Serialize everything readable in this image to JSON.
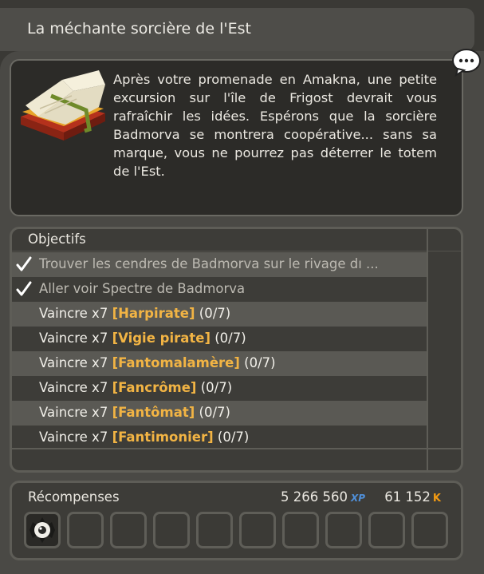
{
  "quest": {
    "title": "La méchante sorcière de l'Est",
    "description": "Après votre promenade en Amakna, une petite excursion sur l'île de Frigost devrait vous rafraîchir les idées. Espérons que la sorcière Badmorva se montrera coopérative... sans sa marque, vous ne pourrez pas déterrer le totem de l'Est."
  },
  "objectives": {
    "header": "Objectifs",
    "done_items": [
      "Trouver les cendres de Badmorva sur le rivage dı ...",
      "Aller voir Spectre de Badmorva"
    ],
    "kill_prefix": "Vaincre x7",
    "kill_items": [
      {
        "mob": "[Harpirate]",
        "progress": "(0/7)"
      },
      {
        "mob": "[Vigie pirate]",
        "progress": "(0/7)"
      },
      {
        "mob": "[Fantomalamère]",
        "progress": "(0/7)"
      },
      {
        "mob": "[Fancrôme]",
        "progress": "(0/7)"
      },
      {
        "mob": "[Fantômat]",
        "progress": "(0/7)"
      },
      {
        "mob": "[Fantimonier]",
        "progress": "(0/7)"
      }
    ]
  },
  "rewards": {
    "title": "Récompenses",
    "xp": "5 266 560",
    "xp_label": "XP",
    "kamas": "61 152",
    "kamas_label": "K",
    "slot_count": 10,
    "item_icon": "eye-orb-icon"
  },
  "icons": {
    "quest_icon": "book-icon",
    "chat_icon": "speech-bubble-icon",
    "check_icon": "checkmark-icon"
  },
  "colors": {
    "mob_name": "#f2b444",
    "xp": "#4f8fd8",
    "kamas": "#f29a12"
  }
}
